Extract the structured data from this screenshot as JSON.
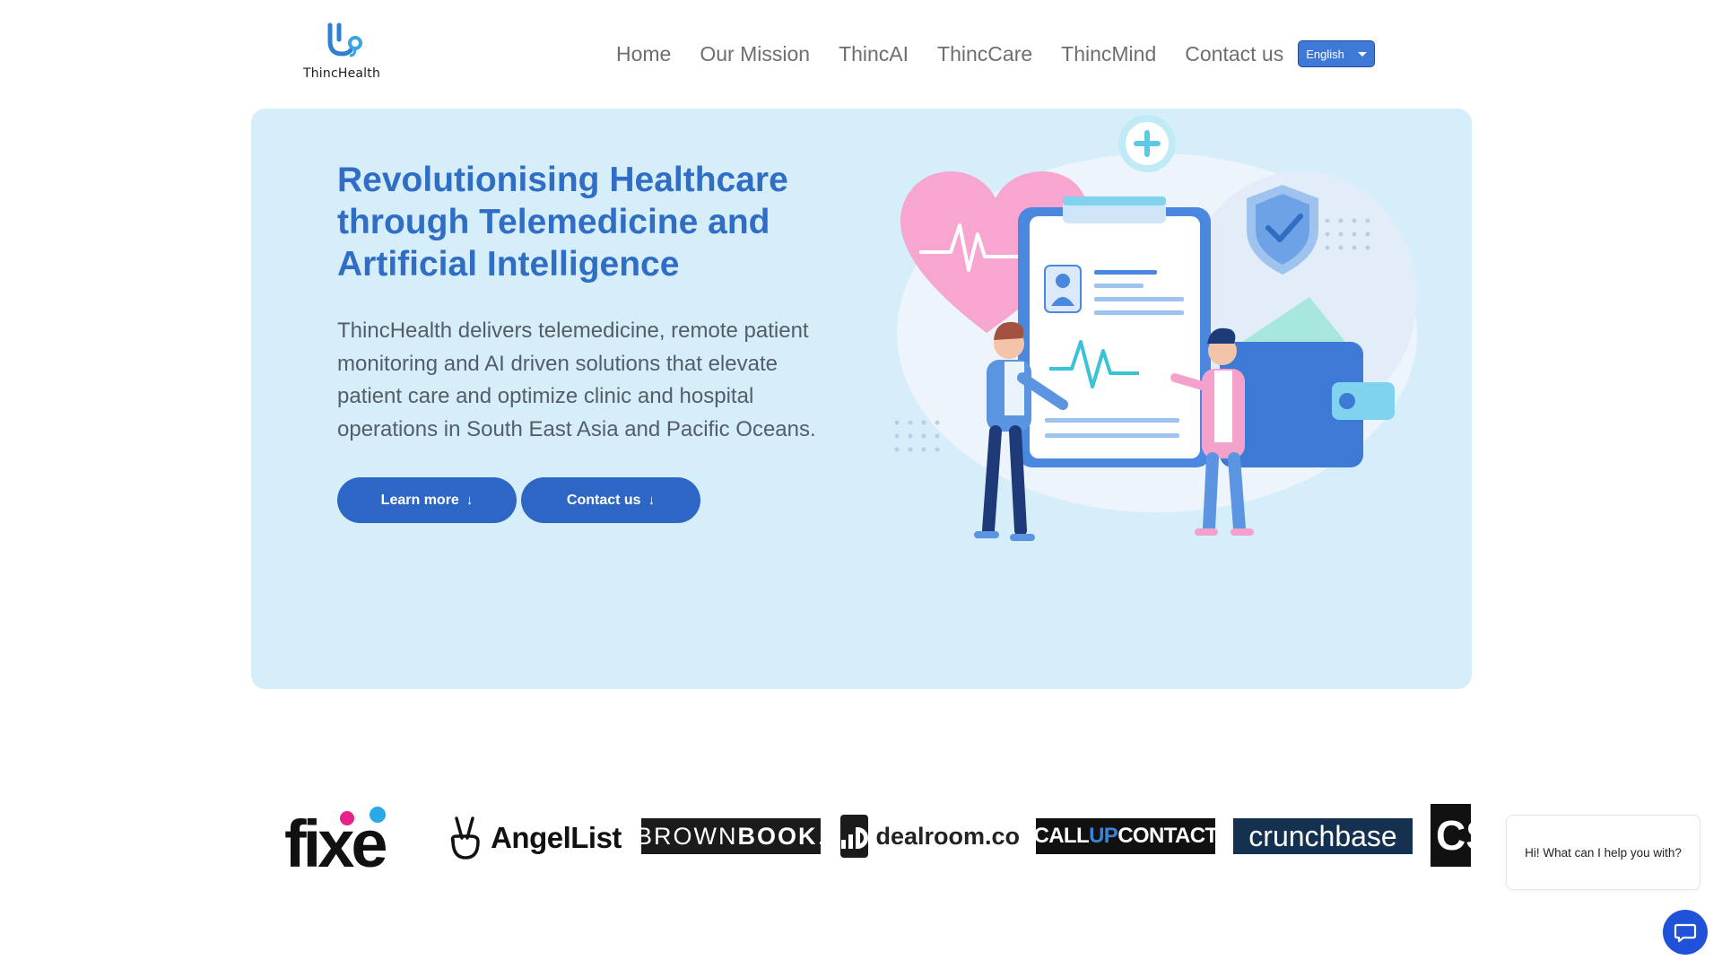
{
  "header": {
    "logo_text": "ThincHealth",
    "nav": [
      "Home",
      "Our Mission",
      "ThincAI",
      "ThincCare",
      "ThincMind",
      "Contact us"
    ],
    "language": "English"
  },
  "hero": {
    "title": "Revolutionising Healthcare through Telemedicine and Artificial Intelligence",
    "description": "ThincHealth delivers telemedicine, remote patient monitoring and AI driven solutions that elevate patient care and optimize clinic and hospital operations in South East Asia and Pacific Oceans.",
    "learn_more": "Learn more",
    "contact_us": "Contact us",
    "arrow": "↓"
  },
  "partners": {
    "fixe": "fixe",
    "angellist": "AngelList",
    "brownbook_a": "BROWN",
    "brownbook_b": "BOOK",
    "brownbook_dot": ".",
    "dealroom": "dealroom.co",
    "callup_a": "CALL",
    "callup_b": "UP",
    "callup_c": "CONTACT",
    "crunchbase": "crunchbase",
    "cs": "CS"
  },
  "chat": {
    "greeting": "Hi! What can I help you with?"
  },
  "colors": {
    "primary": "#2e66c6",
    "hero_bg": "#d5eefa",
    "title": "#2f6ec4",
    "chat": "#1f52d9"
  }
}
